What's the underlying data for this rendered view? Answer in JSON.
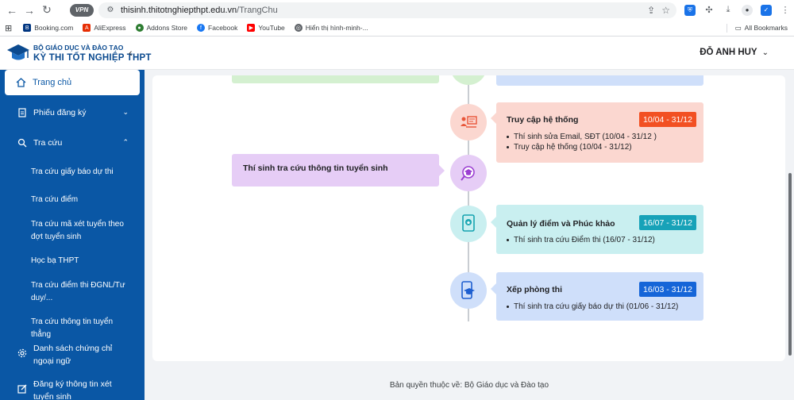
{
  "browser": {
    "vpn_label": "VPN",
    "url_host": "thisinh.thitotnghiepthpt.edu.vn",
    "url_path": "/TrangChu",
    "bookmarks": [
      {
        "label": "Booking.com",
        "color": "#003580",
        "glyph": "B"
      },
      {
        "label": "AliExpress",
        "color": "#e62e04",
        "glyph": "A"
      },
      {
        "label": "Addons Store",
        "color": "#2e7d32",
        "glyph": "●"
      },
      {
        "label": "Facebook",
        "color": "#1877f2",
        "glyph": "f"
      },
      {
        "label": "YouTube",
        "color": "#ff0000",
        "glyph": "▶"
      },
      {
        "label": "Hiển thị hình-minh-...",
        "color": "#5f6368",
        "glyph": "◎"
      }
    ],
    "all_bookmarks": "All Bookmarks"
  },
  "header": {
    "org": "BỘ GIÁO DỤC VÀ ĐÀO TẠO",
    "title": "KỲ THI TỐT NGHIỆP THPT",
    "user_name": "ĐỖ ANH HUY"
  },
  "sidebar": {
    "home": "Trang chủ",
    "registration": "Phiếu đăng ký",
    "lookup": "Tra cứu",
    "sub_items": [
      "Tra cứu giấy báo dự thi",
      "Tra cứu điểm",
      "Tra cứu mã xét tuyển theo đợt tuyển sinh",
      "Học bạ THPT",
      "Tra cứu điểm thi ĐGNL/Tư duy/...",
      "Tra cứu thông tin tuyển thẳng"
    ],
    "certificates": "Danh sách chứng chỉ ngoại ngữ",
    "admission_register": "Đăng ký thông tin xét tuyển sinh"
  },
  "timeline": {
    "access": {
      "title": "Truy cập hệ thống",
      "date": "10/04 - 31/12",
      "bullets": [
        "Thí sinh sửa Email, SĐT (10/04 - 31/12 )",
        "Truy cập hệ thống (10/04 - 31/12)"
      ],
      "badge_color": "#f25022"
    },
    "admission_lookup": {
      "title": "Thí sinh tra cứu thông tin tuyển sinh"
    },
    "scores": {
      "title": "Quản lý điểm và Phúc khảo",
      "date": "16/07 - 31/12",
      "bullets": [
        "Thí sinh tra cứu Điểm thi (16/07 - 31/12)"
      ],
      "badge_color": "#17a2b8"
    },
    "rooms": {
      "title": "Xếp phòng thi",
      "date": "16/03 - 31/12",
      "bullets": [
        "Thí sinh tra cứu giấy báo dự thi (01/06 - 31/12)"
      ],
      "badge_color": "#1565d8"
    }
  },
  "footer": "Bản quyền thuộc về: Bộ Giáo dục và Đào tạo"
}
